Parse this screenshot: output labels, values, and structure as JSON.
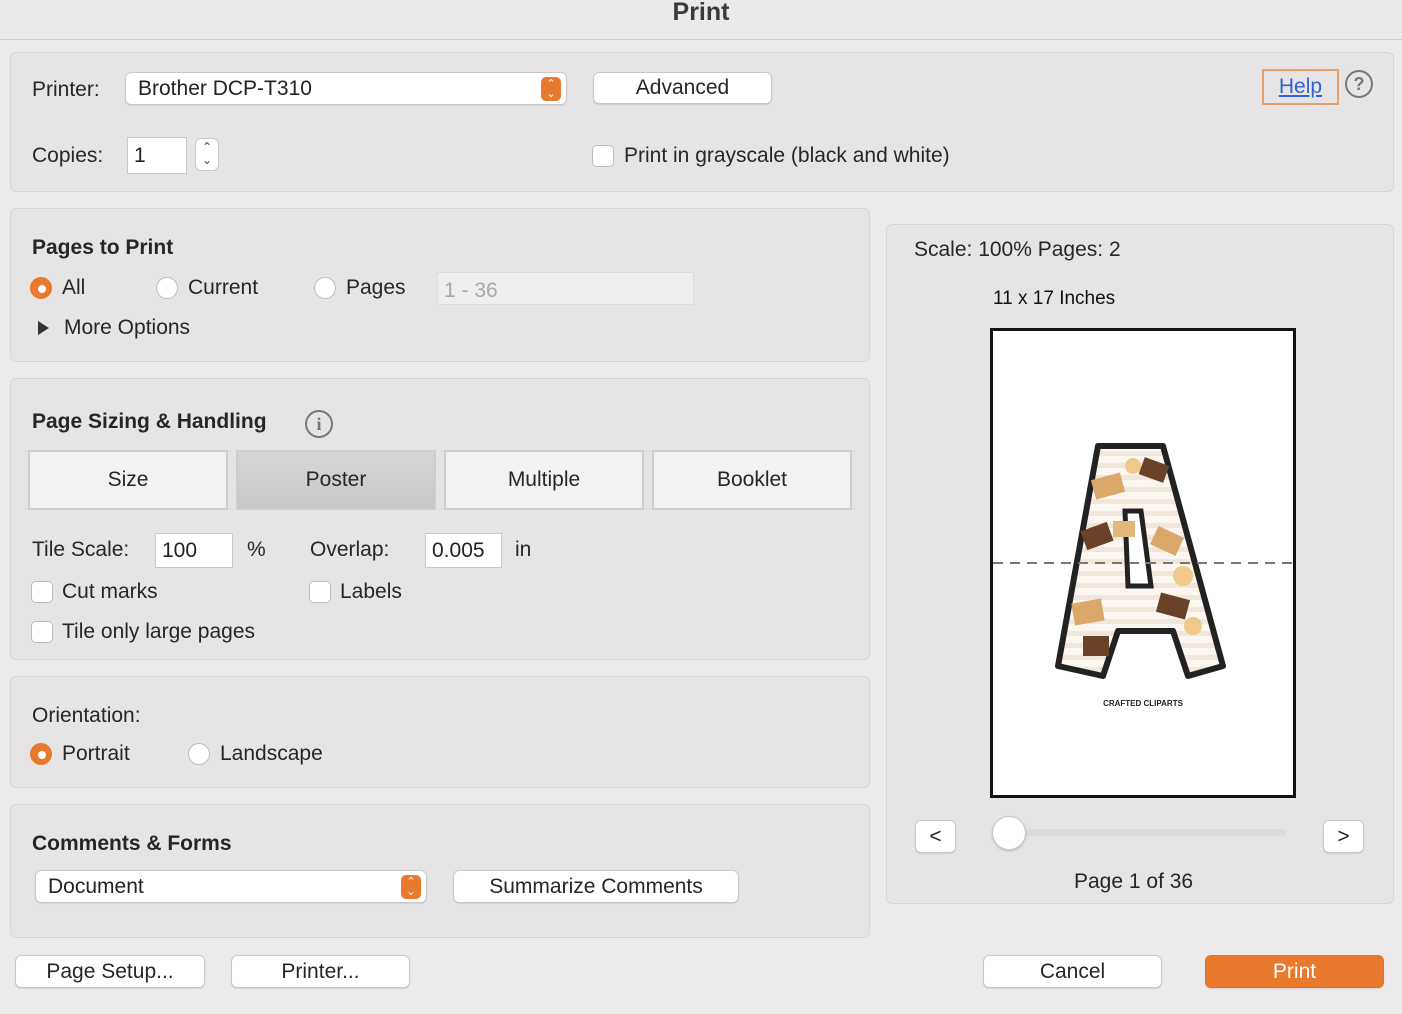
{
  "window": {
    "title": "Print"
  },
  "printer": {
    "label": "Printer:",
    "selected": "Brother DCP-T310",
    "advanced_label": "Advanced",
    "help_label": "Help",
    "help_icon": "?"
  },
  "copies": {
    "label": "Copies:",
    "value": "1",
    "grayscale_label": "Print in grayscale (black and white)"
  },
  "pages_to_print": {
    "heading": "Pages to Print",
    "options": [
      "All",
      "Current",
      "Pages"
    ],
    "selected": "All",
    "range_placeholder": "1 - 36",
    "more_options_label": "More Options"
  },
  "page_sizing": {
    "heading": "Page Sizing & Handling",
    "info_icon": "i",
    "tabs": [
      "Size",
      "Poster",
      "Multiple",
      "Booklet"
    ],
    "selected_tab": "Poster",
    "tile_scale_label": "Tile Scale:",
    "tile_scale_value": "100",
    "tile_scale_unit": "%",
    "overlap_label": "Overlap:",
    "overlap_value": "0.005",
    "overlap_unit": "in",
    "cut_marks_label": "Cut marks",
    "labels_label": "Labels",
    "tile_large_label": "Tile only large pages"
  },
  "orientation": {
    "heading": "Orientation:",
    "options": [
      "Portrait",
      "Landscape"
    ],
    "selected": "Portrait"
  },
  "comments_forms": {
    "heading": "Comments & Forms",
    "selected": "Document",
    "summarize_label": "Summarize Comments"
  },
  "preview": {
    "scale_text": "Scale: 100% Pages: 2",
    "paper_size": "11 x 17 Inches",
    "prev_label": "<",
    "next_label": ">",
    "page_indicator": "Page 1 of 36",
    "slider_position": 0,
    "credit_text": "CRAFTED CLIPARTS"
  },
  "footer": {
    "page_setup_label": "Page Setup...",
    "printer_label": "Printer...",
    "cancel_label": "Cancel",
    "print_label": "Print"
  },
  "colors": {
    "accent": "#e8792d",
    "link": "#2f63d6"
  }
}
